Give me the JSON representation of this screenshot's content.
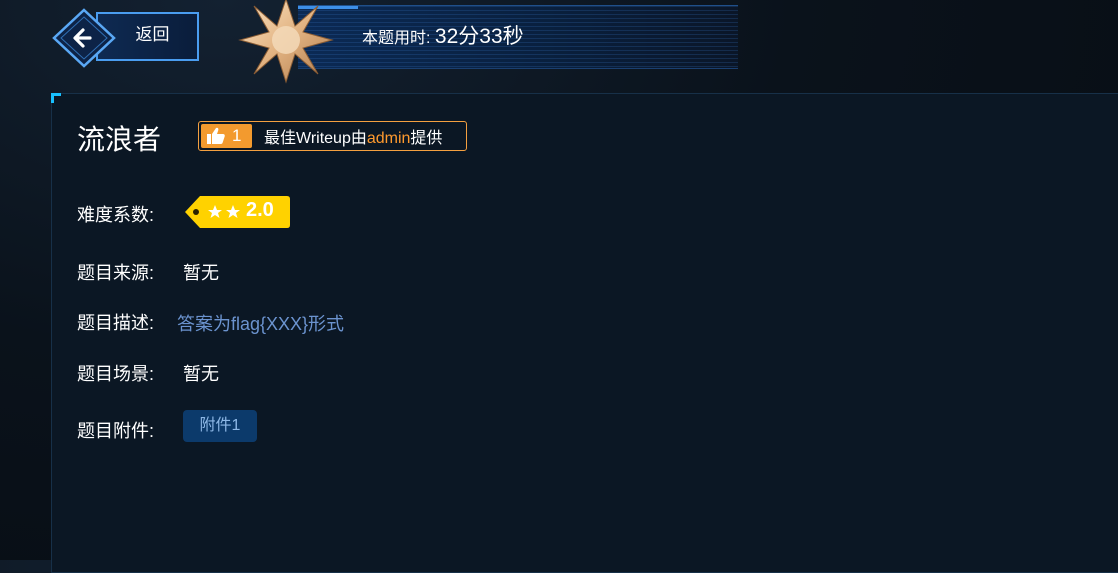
{
  "nav": {
    "back_label": "返回"
  },
  "timer": {
    "label": "本题用时:",
    "value": "32分33秒"
  },
  "challenge": {
    "title": "流浪者",
    "likes": "1",
    "writeup_prefix": "最佳Writeup由",
    "writeup_author": "admin",
    "writeup_suffix": "提供"
  },
  "fields": {
    "difficulty_label": "难度系数:",
    "difficulty_value": "2.0",
    "difficulty_stars": 2,
    "source_label": "题目来源:",
    "source_value": "暂无",
    "description_label": "题目描述:",
    "description_value": "答案为flag{XXX}形式",
    "scene_label": "题目场景:",
    "scene_value": "暂无",
    "attachment_label": "题目附件:",
    "attachment_button": "附件1"
  },
  "icons": {
    "back": "left-arrow-icon",
    "badge": "compass-star-icon",
    "thumbs": "thumbs-up-icon",
    "star": "star-icon"
  },
  "colors": {
    "accent_orange": "#f39a2e",
    "accent_blue": "#4a9df0",
    "difficulty_yellow": "#ffd200",
    "link_blue": "#6b93cf"
  }
}
